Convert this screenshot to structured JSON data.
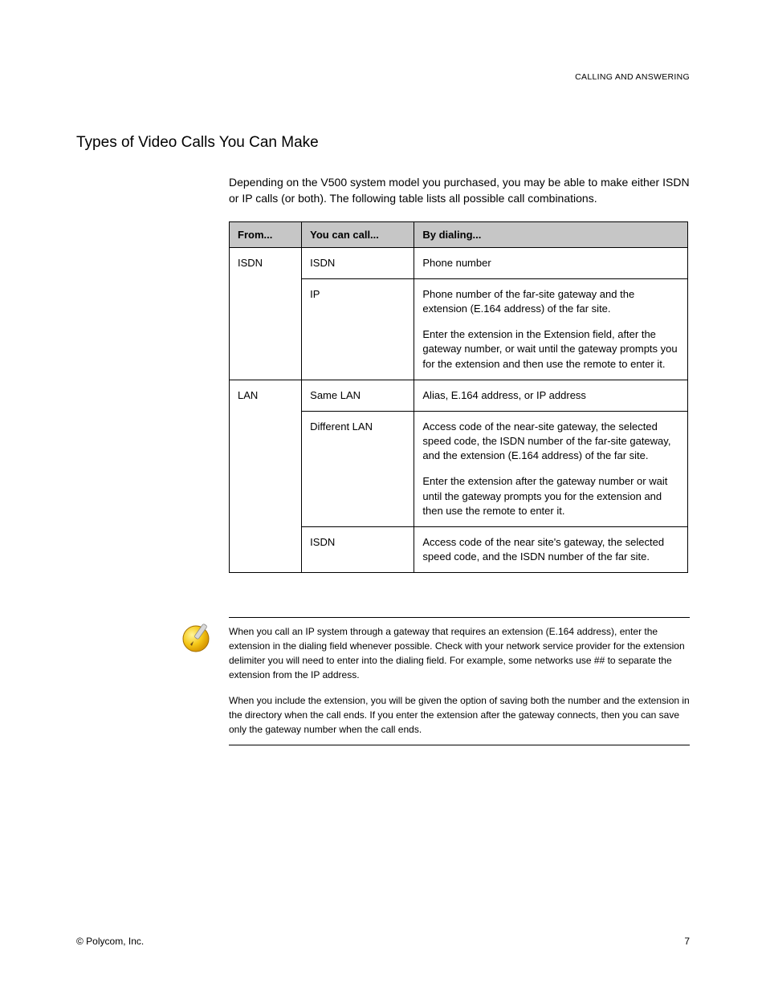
{
  "running_header": "CALLING AND ANSWERING",
  "section_title": "Types of Video Calls You Can Make",
  "intro": "Depending on the V500 system model you purchased, you may be able to make either ISDN or IP calls (or both). The following table lists all possible call combinations.",
  "table": {
    "headers": {
      "from": "From...",
      "call": "You can call...",
      "dial": "By dialing..."
    },
    "groups": [
      {
        "from": "ISDN",
        "rows": [
          {
            "call": "ISDN",
            "dial_paras": [
              "Phone number"
            ]
          },
          {
            "call": "IP",
            "dial_paras": [
              "Phone number of the far-site gateway and the extension (E.164 address) of the far site.",
              "Enter the extension in the Extension field, after the gateway number, or wait until the gateway prompts you for the extension and then use the remote to enter it."
            ]
          }
        ]
      },
      {
        "from": "LAN",
        "rows": [
          {
            "call": "Same LAN",
            "dial_paras": [
              "Alias, E.164 address, or IP address"
            ]
          },
          {
            "call": "Different LAN",
            "dial_paras": [
              "Access code of the near-site gateway, the selected speed code, the ISDN number of the far-site gateway, and the extension (E.164 address) of the far site.",
              "Enter the extension after the gateway number or wait until the gateway prompts you for the extension and then use the remote to enter it."
            ]
          },
          {
            "call": "ISDN",
            "dial_paras": [
              "Access code of the near site's gateway, the selected speed code, and the ISDN number of the far site."
            ]
          }
        ]
      }
    ]
  },
  "note": {
    "paras": [
      "When you call an IP system through a gateway that requires an extension (E.164 address), enter the extension in the dialing field whenever possible. Check with your network service provider for the extension delimiter you will need to enter into the dialing field. For example, some networks use ## to separate the extension from the IP address.",
      "When you include the extension, you will be given the option of saving both the number and the extension in the directory when the call ends. If you enter the extension after the gateway connects, then you can save only the gateway number when the call ends."
    ]
  },
  "footer": {
    "copyright": "© Polycom, Inc.",
    "page_number": "7"
  }
}
